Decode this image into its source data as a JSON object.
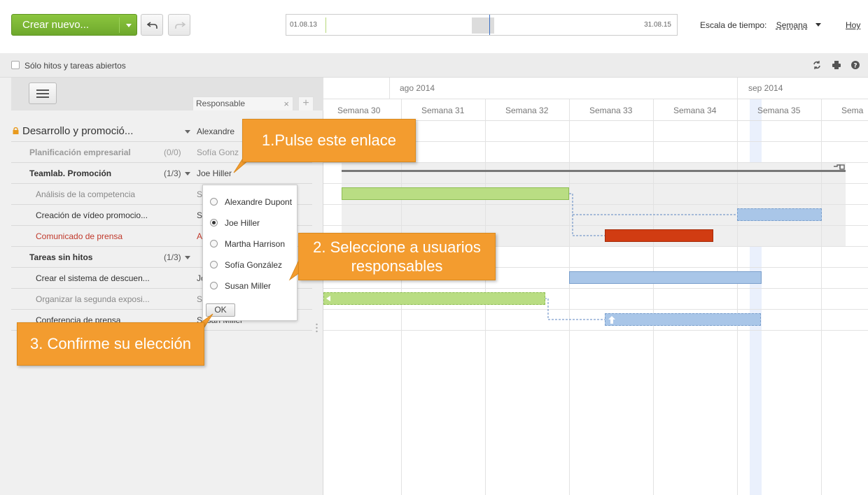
{
  "toolbar": {
    "create_label": "Crear nuevo...",
    "timeline_start": "01.08.13",
    "timeline_end": "31.08.15",
    "scale_label": "Escala de tiempo:",
    "scale_value": "Semana",
    "today_label": "Hoy"
  },
  "filter": {
    "checkbox_label": "Sólo hitos y tareas abiertos"
  },
  "left_panel": {
    "column_header": "Responsable",
    "rows": [
      {
        "name": "Desarrollo y promoció...",
        "count": "",
        "responsible": "Alexandre"
      },
      {
        "name": "Planificación empresarial",
        "count": "(0/0)",
        "responsible": "Sofía Gonz"
      },
      {
        "name": "Teamlab. Promoción",
        "count": "(1/3)",
        "responsible": "Joe Hiller"
      },
      {
        "name": "Análisis de la competencia",
        "count": "",
        "responsible": "S"
      },
      {
        "name": "Creación de vídeo promocio...",
        "count": "",
        "responsible": "S"
      },
      {
        "name": "Comunicado de prensa",
        "count": "",
        "responsible": "A"
      },
      {
        "name": "Tareas sin hitos",
        "count": "(1/3)",
        "responsible": ""
      },
      {
        "name": "Crear el sistema de descuen...",
        "count": "",
        "responsible": "Jo"
      },
      {
        "name": "Organizar la segunda exposi...",
        "count": "",
        "responsible": "S"
      },
      {
        "name": "Conferencia de prensa",
        "count": "",
        "responsible": "Susan Miller"
      }
    ]
  },
  "gantt": {
    "months": [
      "ago 2014",
      "sep 2014"
    ],
    "weeks": [
      "Semana 30",
      "Semana 31",
      "Semana 32",
      "Semana 33",
      "Semana 34",
      "Semana 35",
      "Sema"
    ]
  },
  "popup": {
    "options": [
      "Alexandre Dupont",
      "Joe Hiller",
      "Martha Harrison",
      "Sofía González",
      "Susan Miller"
    ],
    "selected": "Joe Hiller",
    "ok_label": "OK"
  },
  "callouts": {
    "step1": "1.Pulse este enlace",
    "step2_line1": "2. Seleccione a usuarios",
    "step2_line2": "responsables",
    "step3": "3. Confirme su elección"
  },
  "colors": {
    "accent_green": "#7ab734",
    "callout_orange": "#f39c2f",
    "bar_green": "#b9dd83",
    "bar_blue": "#a9c6e8",
    "bar_red": "#d13c12"
  }
}
